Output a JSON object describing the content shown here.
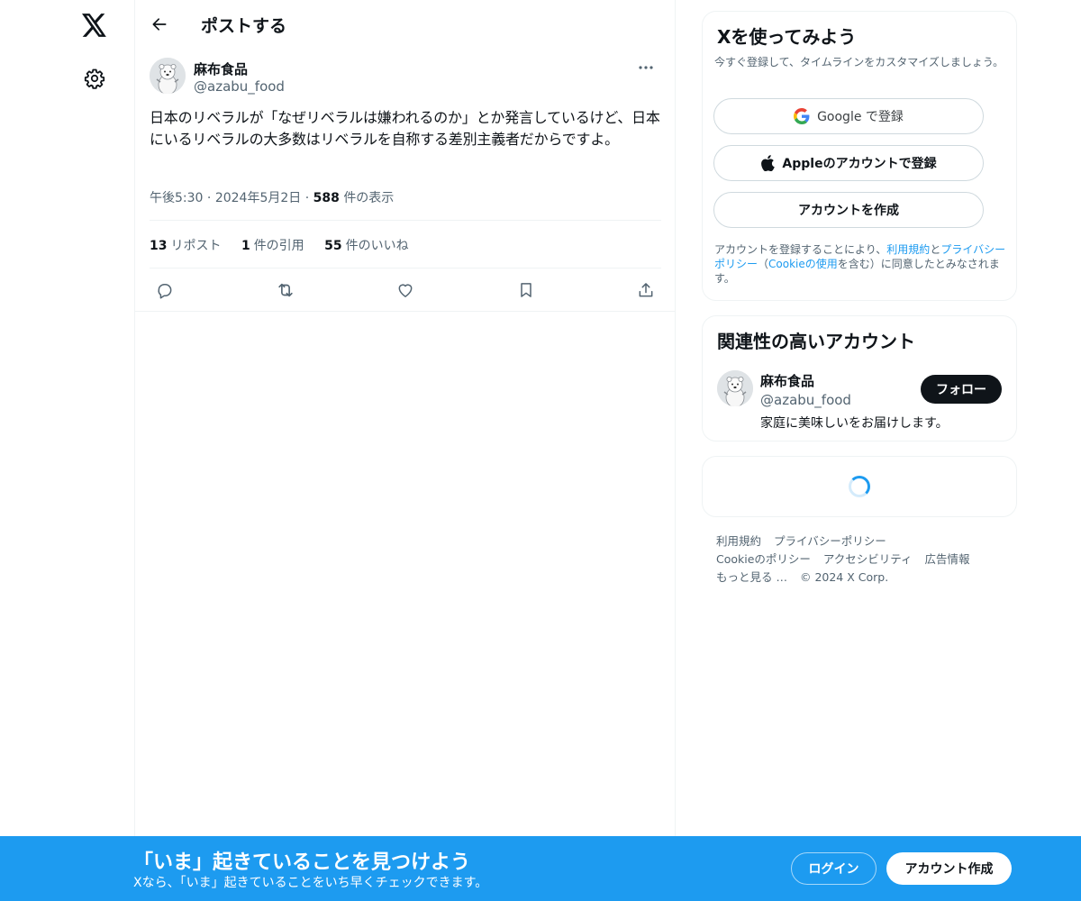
{
  "nav": {
    "logo_icon": "x-logo-icon",
    "settings_icon": "gear-icon"
  },
  "header": {
    "back_icon": "arrow-left-icon",
    "title": "ポストする"
  },
  "post": {
    "author_name": "麻布食品",
    "author_handle": "@azabu_food",
    "text": "日本のリベラルが「なぜリベラルは嫌われるのか」とか発言しているけど、日本にいるリベラルの大多数はリベラルを自称する差別主義者だからですよ。",
    "time": "午後5:30",
    "date": "2024年5月2日",
    "views_count": "588",
    "views_label": "件の表示",
    "stats": [
      {
        "count": "13",
        "label": "リポスト"
      },
      {
        "count": "1",
        "label": "件の引用"
      },
      {
        "count": "55",
        "label": "件のいいね"
      }
    ],
    "actions": [
      "reply-icon",
      "repost-icon",
      "like-icon",
      "bookmark-icon",
      "share-icon"
    ]
  },
  "signup_card": {
    "title": "Xを使ってみよう",
    "subtitle": "今すぐ登録して、タイムラインをカスタマイズしましょう。",
    "google_label": "Google で登録",
    "apple_label": "Appleのアカウントで登録",
    "create_label": "アカウントを作成",
    "terms_prefix": "アカウントを登録することにより、",
    "terms_link": "利用規約",
    "terms_and": "と",
    "privacy_link": "プライバシーポリシー",
    "terms_paren_open": "（",
    "cookie_link": "Cookieの使用",
    "terms_suffix": "を含む）に同意したとみなされます。"
  },
  "related_card": {
    "title": "関連性の高いアカウント",
    "name": "麻布食品",
    "handle": "@azabu_food",
    "bio": "家庭に美味しいをお届けします。",
    "follow_label": "フォロー"
  },
  "footer": {
    "links": [
      "利用規約",
      "プライバシーポリシー",
      "Cookieのポリシー",
      "アクセシビリティ",
      "広告情報",
      "もっと見る …"
    ],
    "copyright": "© 2024 X Corp."
  },
  "banner": {
    "title": "「いま」起きていることを見つけよう",
    "subtitle": "Xなら、「いま」起きていることをいち早くチェックできます。",
    "login_label": "ログイン",
    "signup_label": "アカウント作成"
  },
  "colors": {
    "accent": "#1d9bf0",
    "text": "#0f1419",
    "secondary": "#536471",
    "border": "#eff3f4"
  }
}
